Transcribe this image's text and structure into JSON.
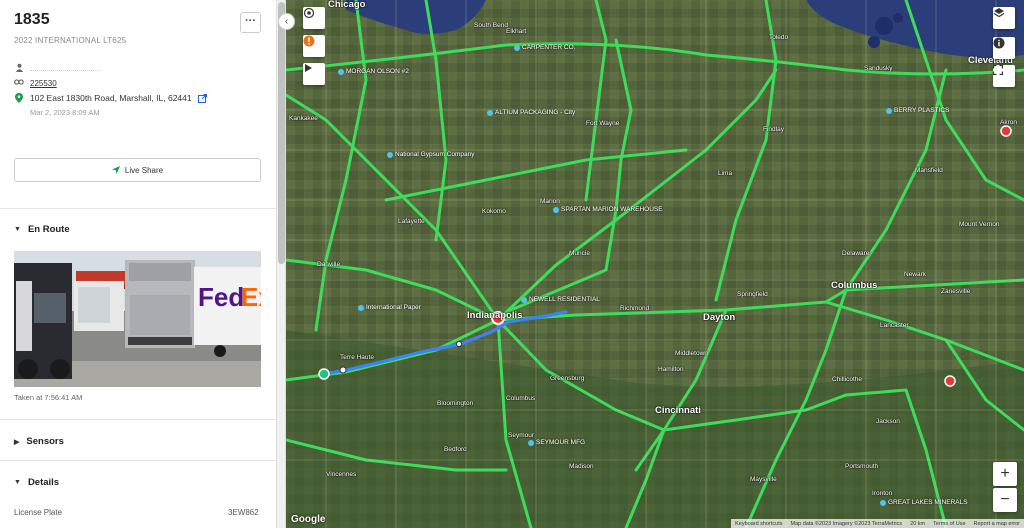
{
  "vehicle": {
    "name": "1835",
    "model": "2022 INTERNATIONAL LT625",
    "more_label": "···",
    "vehicle_id": "225530",
    "address": "102 East 1830th Road, Marshall, IL, 62441",
    "timestamp": "Mar 2, 2023 8:09 AM",
    "live_share_label": "Live Share"
  },
  "sections": {
    "en_route": "En Route",
    "photo_caption": "Taken at 7:56:41 AM",
    "sensors": "Sensors",
    "details": "Details",
    "license_plate_label": "License Plate",
    "license_plate_value": "3EW862"
  },
  "map": {
    "cities": [
      {
        "name": "Chicago",
        "big": true
      },
      {
        "name": "Toledo",
        "big": false
      },
      {
        "name": "Cleveland",
        "big": true
      },
      {
        "name": "Fort Wayne",
        "big": false
      },
      {
        "name": "Indianapolis",
        "big": true
      },
      {
        "name": "Columbus",
        "big": true
      },
      {
        "name": "Dayton",
        "big": true
      },
      {
        "name": "Cincinnati",
        "big": true
      },
      {
        "name": "Terre Haute",
        "big": false
      },
      {
        "name": "Muncie",
        "big": false
      },
      {
        "name": "Richmond",
        "big": false
      },
      {
        "name": "Kokomo",
        "big": false
      },
      {
        "name": "Lafayette",
        "big": false
      },
      {
        "name": "Danville",
        "big": false
      },
      {
        "name": "Bloomington",
        "big": false
      },
      {
        "name": "Lancaster",
        "big": false
      },
      {
        "name": "Mansfield",
        "big": false
      },
      {
        "name": "Akron",
        "big": false
      },
      {
        "name": "Portsmouth",
        "big": false
      },
      {
        "name": "Chillicothe",
        "big": false
      },
      {
        "name": "Springfield",
        "big": false
      },
      {
        "name": "Zanesville",
        "big": false
      },
      {
        "name": "Marion",
        "big": false
      },
      {
        "name": "Lima",
        "big": false
      },
      {
        "name": "Findlay",
        "big": false
      },
      {
        "name": "Sandusky",
        "big": false
      },
      {
        "name": "Kankakee",
        "big": false
      },
      {
        "name": "South Bend",
        "big": false
      },
      {
        "name": "Elkhart",
        "big": false
      },
      {
        "name": "Greensburg",
        "big": false
      },
      {
        "name": "Columbus",
        "big": false
      },
      {
        "name": "Seymour",
        "big": false
      },
      {
        "name": "Madison",
        "big": false
      },
      {
        "name": "Bedford",
        "big": false
      },
      {
        "name": "Vincennes",
        "big": false
      },
      {
        "name": "Jackson",
        "big": false
      },
      {
        "name": "Ironton",
        "big": false
      },
      {
        "name": "Maysville",
        "big": false
      },
      {
        "name": "Hamilton",
        "big": false
      },
      {
        "name": "Middletown",
        "big": false
      },
      {
        "name": "Newark",
        "big": false
      },
      {
        "name": "Delaware",
        "big": false
      },
      {
        "name": "Mount Vernon",
        "big": false
      }
    ],
    "pois": [
      "CARPENTER CO.",
      "MORGAN OLSON #2",
      "ALTIUM PACKAGING - City",
      "National Gypsum Company",
      "SPARTAN MARION WAREHOUSE",
      "NEWELL RESIDENTIAL",
      "International Paper",
      "BERRY PLASTICS",
      "SEYMOUR MFG",
      "GREAT LAKES MINERALS"
    ],
    "footer": [
      "Keyboard shortcuts",
      "Map data ©2023 Imagery ©2023 TerraMetrics",
      "20 km",
      "Terms of Use",
      "Report a map error"
    ],
    "google_label": "Google"
  },
  "colors": {
    "route": "#3b82f6",
    "roads": "#3ddc5a",
    "water": "#2c3e7a",
    "accent_green": "#1a9c4a",
    "marker_red": "#e53935"
  },
  "icons": {
    "user": "user-icon",
    "link": "link-icon",
    "location": "map-pin-icon",
    "external": "external-link-icon",
    "share": "navigation-arrow-icon",
    "layers": "layers-icon",
    "info": "info-icon",
    "fullscreen": "fullscreen-icon"
  }
}
